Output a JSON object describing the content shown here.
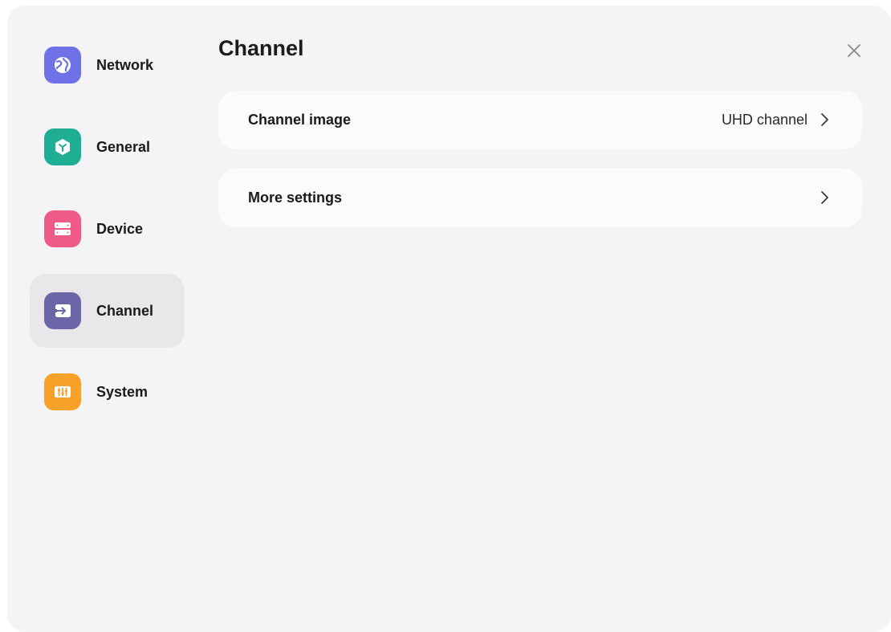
{
  "sidebar": {
    "items": [
      {
        "label": "Network",
        "icon": "network-globe-icon",
        "color": "#6f72e6",
        "active": false
      },
      {
        "label": "General",
        "icon": "general-cube-icon",
        "color": "#1fae93",
        "active": false
      },
      {
        "label": "Device",
        "icon": "device-server-icon",
        "color": "#ef5b86",
        "active": false
      },
      {
        "label": "Channel",
        "icon": "channel-input-icon",
        "color": "#6a66a8",
        "active": true
      },
      {
        "label": "System",
        "icon": "system-sliders-icon",
        "color": "#f8a12a",
        "active": false
      }
    ]
  },
  "main": {
    "title": "Channel",
    "close_icon": "close-icon",
    "rows": [
      {
        "label": "Channel image",
        "value": "UHD channel",
        "icon": "chevron-right-icon"
      },
      {
        "label": "More settings",
        "value": "",
        "icon": "chevron-right-icon"
      }
    ]
  },
  "colors": {
    "window_bg": "#f4f4f7",
    "card_bg": "#fbfbfd",
    "active_bg": "#e8e8ea"
  }
}
